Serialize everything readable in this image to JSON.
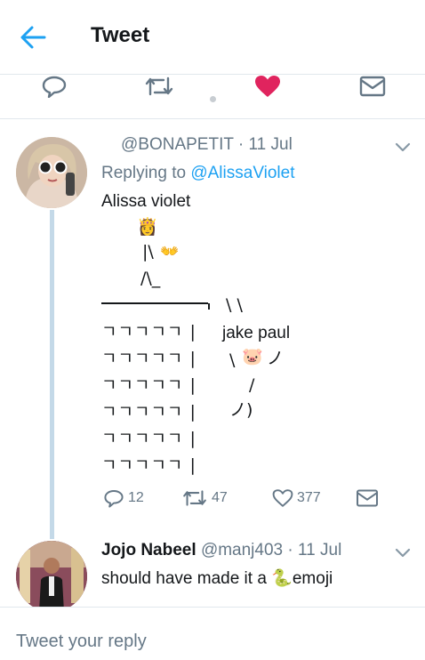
{
  "header": {
    "title": "Tweet"
  },
  "main_tweet": {
    "handle": "@BONAPETIT",
    "time": "· 11 Jul",
    "replying_prefix": "Replying to",
    "replying_handle": "@AlissaViolet",
    "text": "Alissa violet",
    "ascii": {
      "row1": "|\\",
      "row2": "/\\_",
      "bar": "¯¯¯¯¯¯¯¯¯¯¯¯¯|",
      "wall": [
        "ㄱㄱㄱㄱㄱ |",
        "ㄱㄱㄱㄱㄱ |",
        "ㄱㄱㄱㄱㄱ |",
        "ㄱㄱㄱㄱㄱ |",
        "ㄱㄱㄱㄱㄱ |",
        "ㄱㄱㄱㄱㄱ |"
      ],
      "fall_lines": "\\ \\",
      "label": "jake paul",
      "body1": "\\",
      "body1b": "ノ",
      "body2": "/",
      "body3": "ノ)"
    },
    "stats": {
      "replies": "12",
      "retweets": "47",
      "likes": "377"
    }
  },
  "reply": {
    "name": "Jojo Nabeel",
    "handle": "@manj403",
    "time": "· 11 Jul",
    "text": "should have made it a",
    "text_end": "emoji"
  },
  "reply_bar": {
    "placeholder": "Tweet your reply"
  },
  "colors": {
    "accent": "#1da1f2",
    "like": "#e0245e",
    "muted": "#657786",
    "thread": "#c4d9e8"
  },
  "icons": [
    "back-arrow-icon",
    "reply-icon",
    "retweet-icon",
    "heart-icon",
    "message-icon",
    "chevron-down-icon",
    "princess-emoji",
    "hands-emoji",
    "pig-emoji",
    "snake-emoji"
  ]
}
